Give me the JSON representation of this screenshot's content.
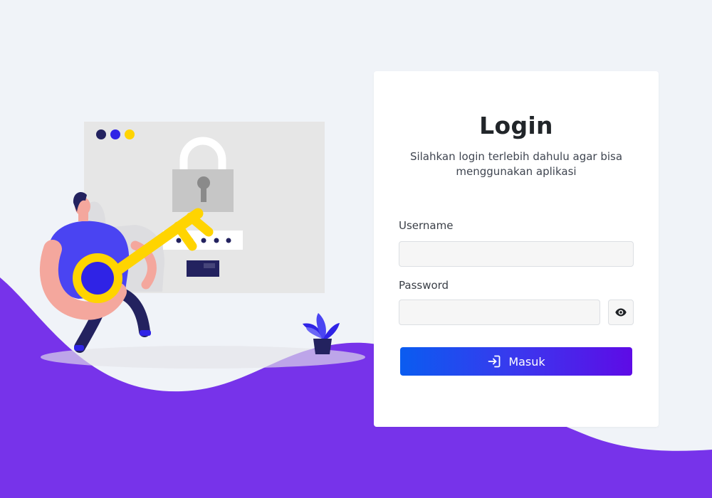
{
  "colors": {
    "background": "#F0F3F8",
    "wave": "#7733EA",
    "accent_blue": "#2F23E6",
    "key_yellow": "#FFD400",
    "button_gradient_start": "#0A5CF0",
    "button_gradient_end": "#5E0BE6"
  },
  "login": {
    "title": "Login",
    "subtitle": "Silahkan login terlebih dahulu agar bisa menggunakan aplikasi",
    "username_label": "Username",
    "username_value": "",
    "username_placeholder": "",
    "password_label": "Password",
    "password_value": "",
    "password_placeholder": "",
    "toggle_password_icon": "eye-icon",
    "submit_label": "Masuk",
    "submit_icon": "login-icon"
  },
  "illustration": {
    "subject": "person-carrying-key-icon",
    "window_icon": "padlock-icon",
    "plant_icon": "plant-icon"
  }
}
